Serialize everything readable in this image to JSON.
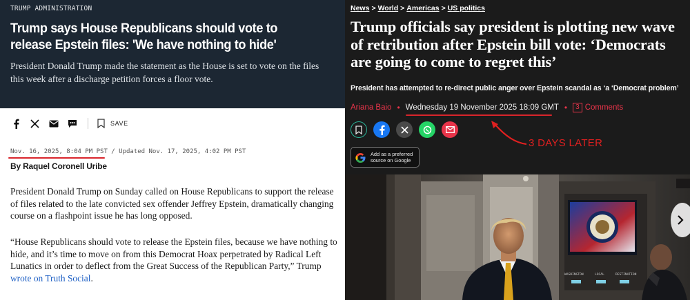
{
  "left": {
    "kicker": "TRUMP ADMINISTRATION",
    "headline": "Trump says House Republicans should vote to release Epstein files: 'We have nothing to hide'",
    "dek": "President Donald Trump made the statement as the House is set to vote on the files this week after a discharge petition forces a floor vote.",
    "share": {
      "icons": [
        "facebook-icon",
        "x-icon",
        "email-icon",
        "sms-icon",
        "bookmark-icon"
      ],
      "save_label": "SAVE"
    },
    "dateline": {
      "published": "Nov. 16, 2025, 8:04 PM PST",
      "updated": " / Updated Nov. 17, 2025, 4:02 PM PST"
    },
    "byline": "By Raquel Coronell Uribe",
    "para1": "President Donald Trump on Sunday called on House Republicans to support the release of files related to the late convicted sex offender Jeffrey Epstein, dramatically changing course on a flashpoint issue he has long opposed.",
    "para2_text": "“House Republicans should vote to release the Epstein files, because we have nothing to hide, and it’s time to move on from this Democrat Hoax perpetrated by Radical Left Lunatics in order to deflect from the Great Success of the Republican Party,” Trump ",
    "para2_link": "wrote on Truth Social",
    "para2_end": "."
  },
  "right": {
    "breadcrumbs": [
      "News",
      "World",
      "Americas",
      "US politics"
    ],
    "breadcrumb_sep": ">",
    "headline": "Trump officials say president is plotting new wave of retribution after Epstein bill vote: ‘Democrats are going to come to regret this’",
    "standfirst": "President has attempted to re-direct public anger over Epstein scandal as ‘a ‘Democrat problem’",
    "author": "Ariana Baio",
    "date": "Wednesday 19 November 2025 18:09 GMT",
    "comment_count": "3",
    "comments_label": "Comments",
    "social_icons": [
      "bookmark-icon",
      "facebook-icon",
      "x-icon",
      "whatsapp-icon",
      "email-icon"
    ],
    "annotation": "3 DAYS LATER",
    "google_btn_line1": "Add as a preferred",
    "google_btn_line2": "source on Google",
    "photo_labels": [
      "WASHINGTON",
      "LOCAL",
      "DESTINATION"
    ]
  },
  "colors": {
    "left_hero_bg": "#1c2733",
    "right_bg": "#1b1b1b",
    "accent_red": "#e8344a",
    "annotation_red": "#e02020",
    "link_blue": "#1d5fc4"
  }
}
